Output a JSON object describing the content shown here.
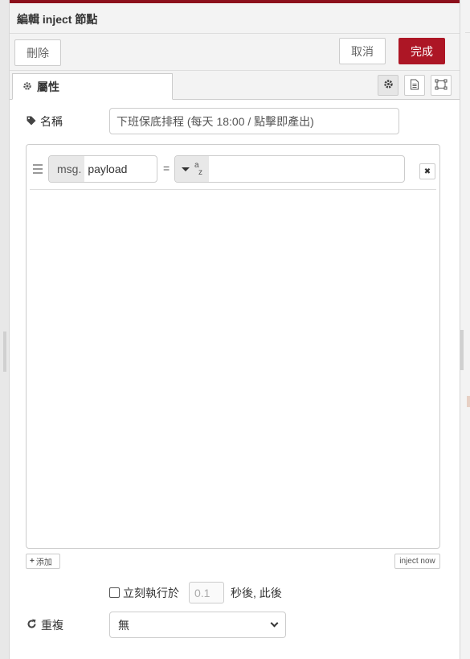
{
  "dialog": {
    "title": "編輯 inject 節點"
  },
  "toolbar": {
    "delete_label": "刪除",
    "cancel_label": "取消",
    "done_label": "完成",
    "done_color": "#ad1625"
  },
  "tabs": {
    "properties_label": "屬性"
  },
  "form": {
    "name_label": "名稱",
    "name_value": "下班保底排程 (每天 18:00 / 點擊即產出)",
    "properties": [
      {
        "prefix": "msg.",
        "field": "payload",
        "operator": "=",
        "type_icon": "string-type-icon",
        "type_glyph_a": "a",
        "type_glyph_z": "z",
        "value": ""
      }
    ],
    "add_label": "添加",
    "inject_now_label": "inject now",
    "once_label": "立刻執行於",
    "once_checked": false,
    "once_delay_placeholder": "0.1",
    "once_after_label": "秒後, 此後",
    "repeat_label": "重複",
    "repeat_value": "無"
  }
}
